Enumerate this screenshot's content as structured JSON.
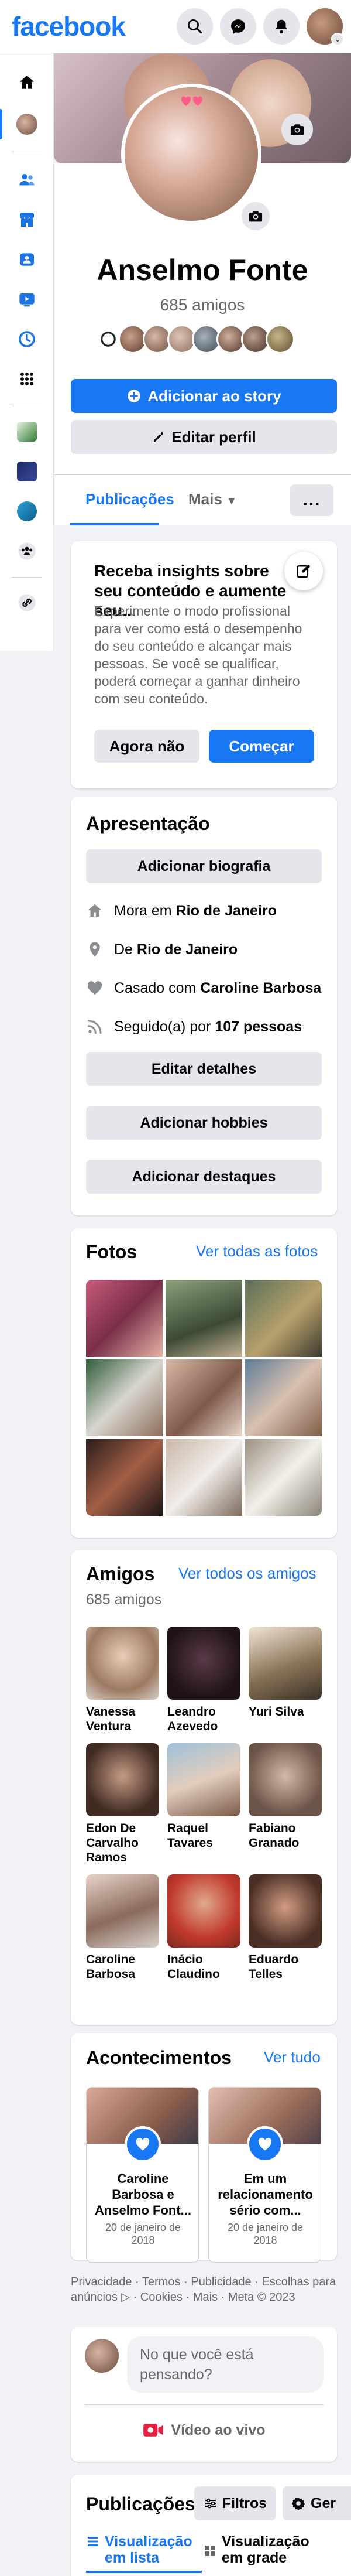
{
  "header": {
    "logo": "facebook"
  },
  "profile": {
    "name": "Anselmo Fonte",
    "friends_count": "685 amigos",
    "add_story_label": "Adicionar ao story",
    "edit_profile_label": "Editar perfil"
  },
  "tabs": {
    "posts": "Publicações",
    "more": "Mais",
    "dots": "..."
  },
  "insights": {
    "title": "Receba insights sobre seu conteúdo e aumente seu...",
    "text": "Experimente o modo profissional para ver como está o desempenho do seu conteúdo e alcançar mais pessoas. Se você se qualificar, poderá começar a ganhar dinheiro com seu conteúdo.",
    "not_now": "Agora não",
    "start": "Começar"
  },
  "intro": {
    "title": "Apresentação",
    "add_bio": "Adicionar biografia",
    "lives_in_prefix": "Mora em ",
    "lives_in": "Rio de Janeiro",
    "from_prefix": "De ",
    "from": "Rio de Janeiro",
    "married_prefix": "Casado com ",
    "married_to": "Caroline Barbosa",
    "followed_prefix": "Seguido(a) por ",
    "followers": "107 pessoas",
    "edit_details": "Editar detalhes",
    "add_hobbies": "Adicionar hobbies",
    "add_highlights": "Adicionar destaques"
  },
  "photos": {
    "title": "Fotos",
    "see_all": "Ver todas as fotos"
  },
  "friends": {
    "title": "Amigos",
    "see_all": "Ver todos os amigos",
    "count": "685 amigos",
    "list": [
      {
        "name": "Vanessa Ventura"
      },
      {
        "name": "Leandro Azevedo"
      },
      {
        "name": "Yuri Silva"
      },
      {
        "name": "Edon De Carvalho Ramos"
      },
      {
        "name": "Raquel Tavares"
      },
      {
        "name": "Fabiano Granado"
      },
      {
        "name": "Caroline Barbosa"
      },
      {
        "name": "Inácio Claudino"
      },
      {
        "name": "Eduardo Telles"
      }
    ]
  },
  "life_events": {
    "title": "Acontecimentos",
    "see_all": "Ver tudo",
    "items": [
      {
        "title": "Caroline Barbosa e Anselmo Font...",
        "date": "20 de janeiro de 2018"
      },
      {
        "title": "Em um relacionamento sério com...",
        "date": "20 de janeiro de 2018"
      }
    ]
  },
  "footer": {
    "links": "Privacidade · Termos · Publicidade · Escolhas para anúncios ▷ · Cookies · Mais · Meta © 2023"
  },
  "composer": {
    "placeholder": "No que você está pensando?",
    "live_video": "Vídeo ao vivo"
  },
  "posts": {
    "title": "Publicações",
    "filters": "Filtros",
    "manage": "Ger",
    "list_view": "Visualização em lista",
    "grid_view": "Visualização em grade"
  },
  "colors": {
    "brand": "#1877f2",
    "background": "#f0f2f5",
    "secondary_button": "#e4e6eb",
    "muted_text": "#65676b",
    "live_red": "#e41e3f"
  }
}
